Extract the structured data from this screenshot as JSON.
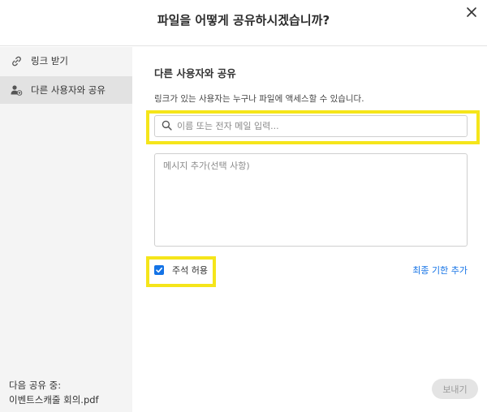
{
  "dialog": {
    "title": "파일을 어떻게 공유하시겠습니까?",
    "close_icon": "close-icon"
  },
  "sidebar": {
    "items": [
      {
        "label": "링크 받기",
        "icon": "link-icon",
        "active": false
      },
      {
        "label": "다른 사용자와 공유",
        "icon": "add-user-icon",
        "active": true
      }
    ],
    "footer_label": "다음 공유 중:",
    "footer_file": "이벤트스캐줄 회의.pdf"
  },
  "main": {
    "section_title": "다른 사용자와 공유",
    "subtitle": "링크가 있는 사용자는 누구나 파일에 액세스할 수 있습니다.",
    "search": {
      "placeholder": "이름 또는 전자 메일 입력...",
      "value": ""
    },
    "message": {
      "placeholder": "메시지 추가(선택 사항)",
      "value": ""
    },
    "allow_comments": {
      "label": "주석 허용",
      "checked": true
    },
    "deadline_link": "최종 기한 추가",
    "send_button": "보내기"
  },
  "colors": {
    "highlight": "#f5e51a",
    "accent": "#1473e6",
    "sidebar_bg": "#f4f4f4",
    "active_item_bg": "#e2e2e2"
  }
}
